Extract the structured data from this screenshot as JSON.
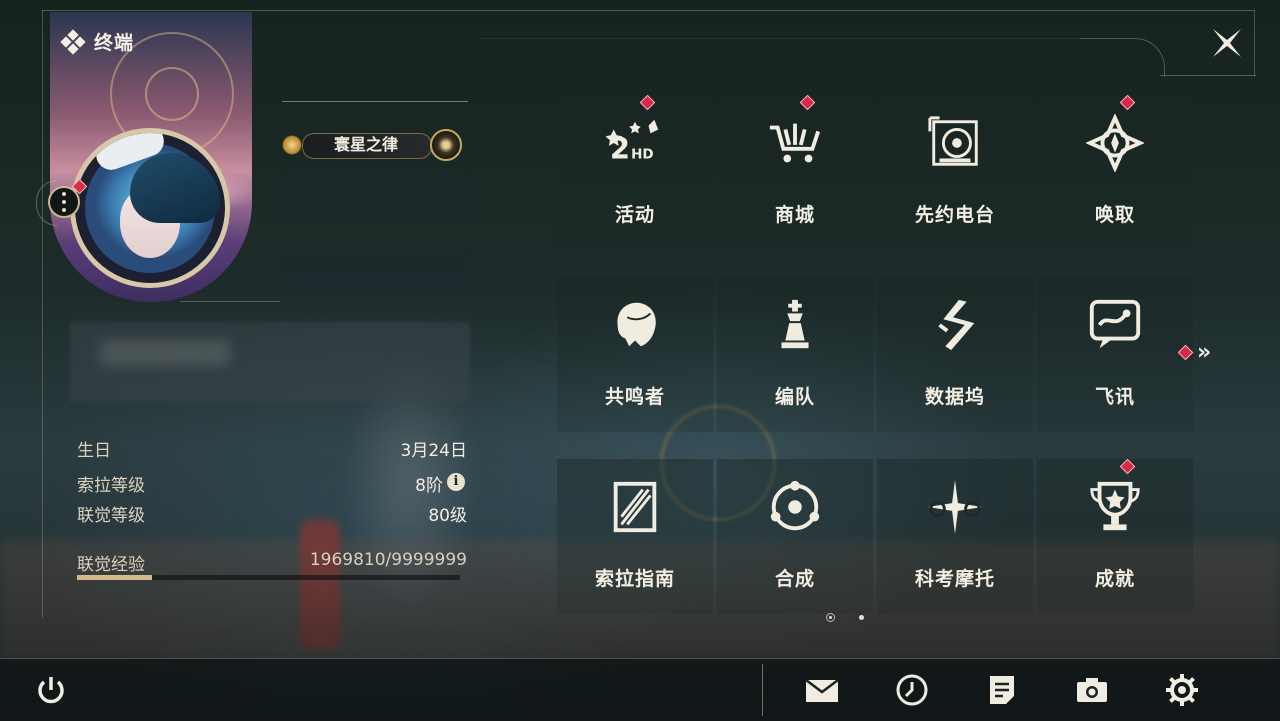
{
  "panel": {
    "title": "终端",
    "title_icon": "diamond-cluster-icon",
    "badge_title": "寰星之律"
  },
  "profile": {
    "stats": [
      {
        "label": "生日",
        "value": "3月24日"
      },
      {
        "label": "索拉等级",
        "value": "8阶",
        "info_icon": "info-icon"
      },
      {
        "label": "联觉等级",
        "value": "80级"
      }
    ],
    "exp": {
      "label": "联觉经验",
      "value": "1969810/9999999",
      "fraction": 0.197
    }
  },
  "menu": {
    "tiles": [
      {
        "label": "活动",
        "icon": "event-2hd-icon",
        "alert": true
      },
      {
        "label": "商城",
        "icon": "shop-cart-icon",
        "alert": true
      },
      {
        "label": "先约电台",
        "icon": "radio-icon",
        "alert": false
      },
      {
        "label": "唤取",
        "icon": "summon-compass-icon",
        "alert": true
      },
      {
        "label": "共鸣者",
        "icon": "resonator-head-icon",
        "alert": false
      },
      {
        "label": "编队",
        "icon": "team-chess-icon",
        "alert": false
      },
      {
        "label": "数据坞",
        "icon": "databank-icon",
        "alert": false
      },
      {
        "label": "飞讯",
        "icon": "message-chat-icon",
        "alert": false
      },
      {
        "label": "索拉指南",
        "icon": "guide-book-icon",
        "alert": false
      },
      {
        "label": "合成",
        "icon": "synthesis-icon",
        "alert": false
      },
      {
        "label": "科考摩托",
        "icon": "motorbike-icon",
        "alert": false
      },
      {
        "label": "成就",
        "icon": "trophy-icon",
        "alert": true
      }
    ],
    "next_page_icon": "double-chevron-right-icon",
    "pages": 2,
    "current_page": 1
  },
  "bottom_bar": {
    "left": [
      {
        "icon": "power-icon"
      }
    ],
    "right": [
      {
        "icon": "mail-icon"
      },
      {
        "icon": "clock-icon"
      },
      {
        "icon": "notice-icon"
      },
      {
        "icon": "camera-icon"
      },
      {
        "icon": "settings-gear-icon"
      }
    ]
  },
  "colors": {
    "accent_gold": "#d4b889",
    "alert_red": "#d42a44",
    "text_light": "#f3eee3"
  }
}
